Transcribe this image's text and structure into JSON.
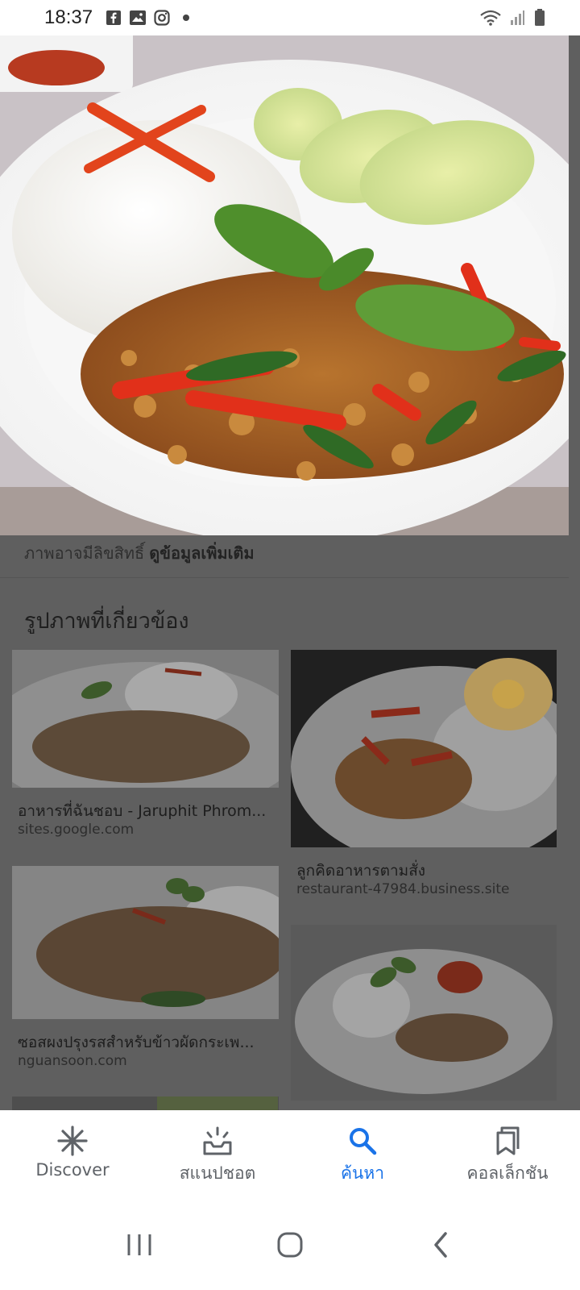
{
  "status": {
    "time": "18:37",
    "left_icons": [
      "facebook-icon",
      "gallery-icon",
      "instagram-icon",
      "dot-icon"
    ],
    "right_icons": [
      "wifi-icon",
      "signal-icon",
      "battery-icon"
    ]
  },
  "hero": {
    "credit_text": "ภาพอาจมีลิขสิทธิ์",
    "credit_link": "ดูข้อมูลเพิ่มเติม"
  },
  "related": {
    "title": "รูปภาพที่เกี่ยวข้อง",
    "cards": [
      {
        "caption": "อาหารที่ฉันชอบ - Jaruphit Phrom...",
        "site": "sites.google.com"
      },
      {
        "caption": "ลูกคิดอาหารตามสั่ง",
        "site": "restaurant-47984.business.site"
      },
      {
        "caption": "ซอสผงปรุงรสสำหรับข้าวผัดกระเพ...",
        "site": "nguansoon.com"
      },
      {
        "caption": "",
        "site": ""
      }
    ]
  },
  "bottom_nav": {
    "items": [
      {
        "label": "Discover",
        "icon": "asterisk-icon"
      },
      {
        "label": "สแนปชอต",
        "icon": "snapshot-icon"
      },
      {
        "label": "ค้นหา",
        "icon": "search-icon"
      },
      {
        "label": "คอลเล็กชัน",
        "icon": "collections-icon"
      }
    ],
    "active_index": 2,
    "active_color": "#1a73e8"
  },
  "system_nav": [
    "recents-icon",
    "home-icon",
    "back-icon"
  ]
}
